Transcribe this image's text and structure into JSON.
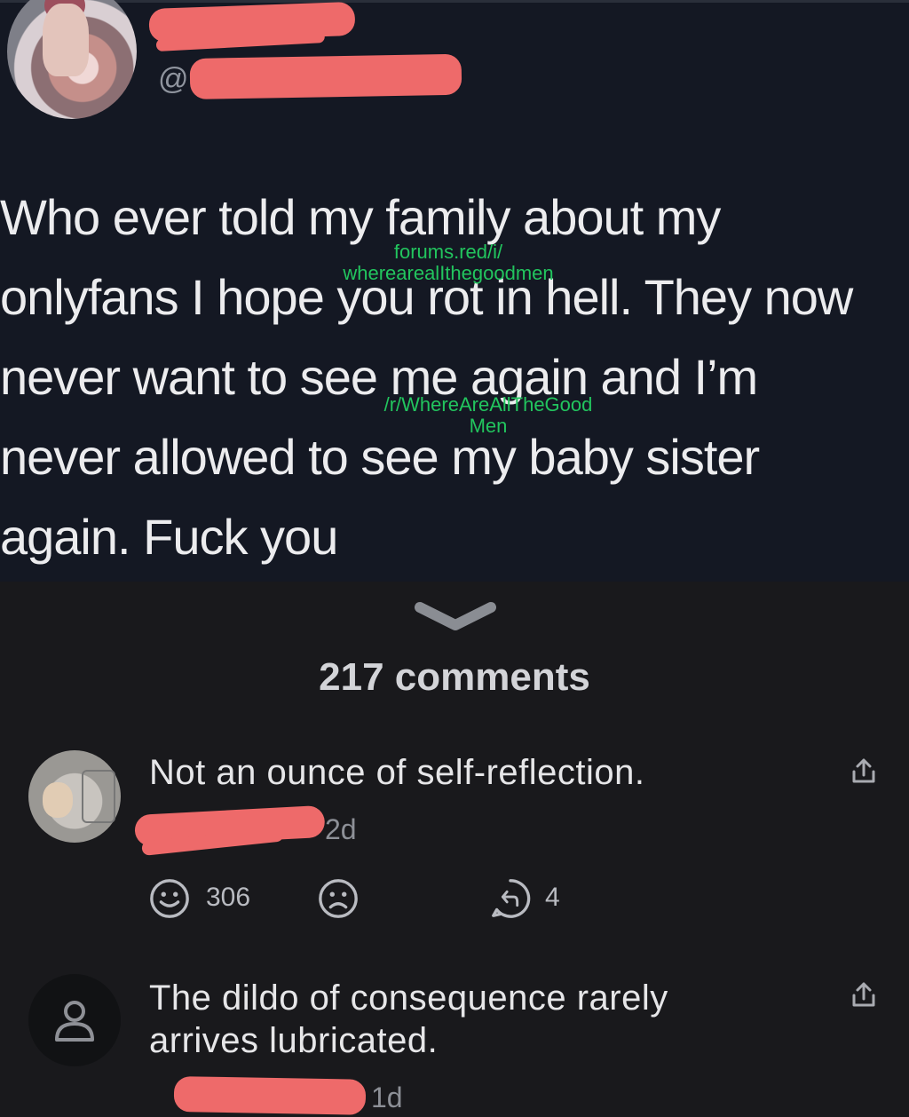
{
  "post": {
    "handle_prefix": "@",
    "text": "Who ever told my family about my\nonlyfans I hope you rot in hell. They now\nnever want to see me again and I’m\nnever allowed to see my baby sister\nagain. Fuck you",
    "watermark_1": "forums.red/i/\nwherearealIthegoodmen",
    "watermark_2": "/r/WhereAreAllTheGood\nMen"
  },
  "comments_header": {
    "label": "217 comments"
  },
  "comments": [
    {
      "text": "Not an ounce of self-reflection.",
      "age": "2d",
      "likes": "306",
      "replies": "4"
    },
    {
      "text": "The dildo of consequence rarely\narrives lubricated.",
      "age": "1d"
    }
  ],
  "colors": {
    "post_bg": "#141823",
    "page_bg": "#19191c",
    "redaction": "#ee6a6a",
    "watermark": "#22c55e"
  },
  "icons": [
    "share-icon",
    "smile-icon",
    "frown-icon",
    "reply-icon",
    "user-icon",
    "chevron-down-icon"
  ]
}
